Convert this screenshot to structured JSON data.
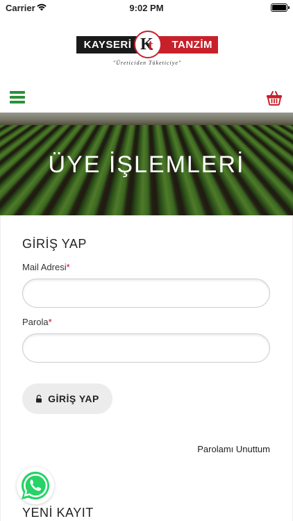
{
  "status_bar": {
    "carrier": "Carrier",
    "time": "9:02 PM"
  },
  "logo": {
    "left_text": "KAYSERİ",
    "right_text": "TANZİM",
    "tagline": "\"Üreticiden Tüketiciye\""
  },
  "hero": {
    "title": "ÜYE İŞLEMLERİ"
  },
  "login": {
    "title": "GİRİŞ YAP",
    "email_label": "Mail Adresi",
    "password_label": "Parola",
    "required_mark": "*",
    "button_label": "GİRİŞ YAP",
    "forgot_label": "Parolamı Unuttum"
  },
  "signup": {
    "title": "YENİ KAYIT"
  },
  "colors": {
    "brand_red": "#c8202a",
    "brand_green": "#2f8f3a",
    "whatsapp_green": "#25d366"
  },
  "icons": [
    "wifi-icon",
    "battery-icon",
    "hamburger-menu-icon",
    "shopping-basket-icon",
    "lock-icon",
    "whatsapp-icon"
  ]
}
